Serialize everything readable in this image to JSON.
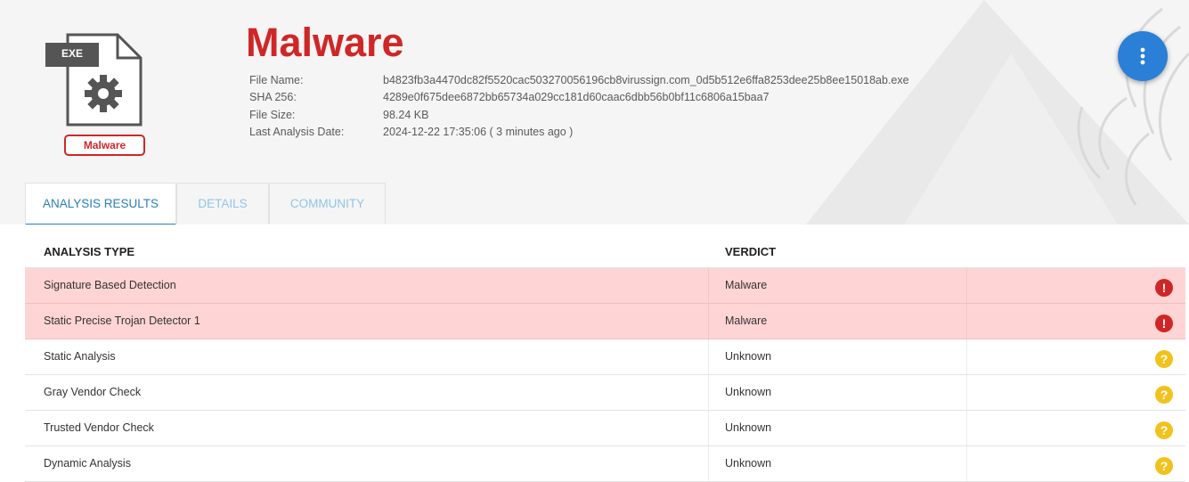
{
  "file": {
    "type_label": "EXE",
    "badge": "Malware",
    "title": "Malware",
    "fields": [
      {
        "label": "File Name:",
        "value": "b4823fb3a4470dc82f5520cac503270056196cb8virussign.com_0d5b512e6ffa8253dee25b8ee15018ab.exe"
      },
      {
        "label": "SHA 256:",
        "value": "4289e0f675dee6872bb65734a029cc181d60caac6dbb56b0bf11c6806a15baa7"
      },
      {
        "label": "File Size:",
        "value": "98.24 KB"
      },
      {
        "label": "Last Analysis Date:",
        "value": "2024-12-22 17:35:06 ( 3 minutes ago )"
      }
    ]
  },
  "tabs": [
    {
      "label": "ANALYSIS RESULTS",
      "active": true
    },
    {
      "label": "DETAILS",
      "active": false
    },
    {
      "label": "COMMUNITY",
      "active": false
    }
  ],
  "table": {
    "headers": [
      "ANALYSIS TYPE",
      "VERDICT"
    ],
    "rows": [
      {
        "type": "Signature Based Detection",
        "verdict": "Malware",
        "icon": "error-icon"
      },
      {
        "type": "Static Precise Trojan Detector 1",
        "verdict": "Malware",
        "icon": "error-icon"
      },
      {
        "type": "Static Analysis",
        "verdict": "Unknown",
        "icon": "question-icon"
      },
      {
        "type": "Gray Vendor Check",
        "verdict": "Unknown",
        "icon": "question-icon"
      },
      {
        "type": "Trusted Vendor Check",
        "verdict": "Unknown",
        "icon": "question-icon"
      },
      {
        "type": "Dynamic Analysis",
        "verdict": "Unknown",
        "icon": "question-icon"
      }
    ]
  },
  "colors": {
    "malware_red": "#cf2727",
    "row_bad_bg": "#ffd4d4",
    "unknown_yellow": "#f2c21c",
    "fab_blue": "#2a7fd6",
    "tab_active": "#2a7fb8"
  }
}
